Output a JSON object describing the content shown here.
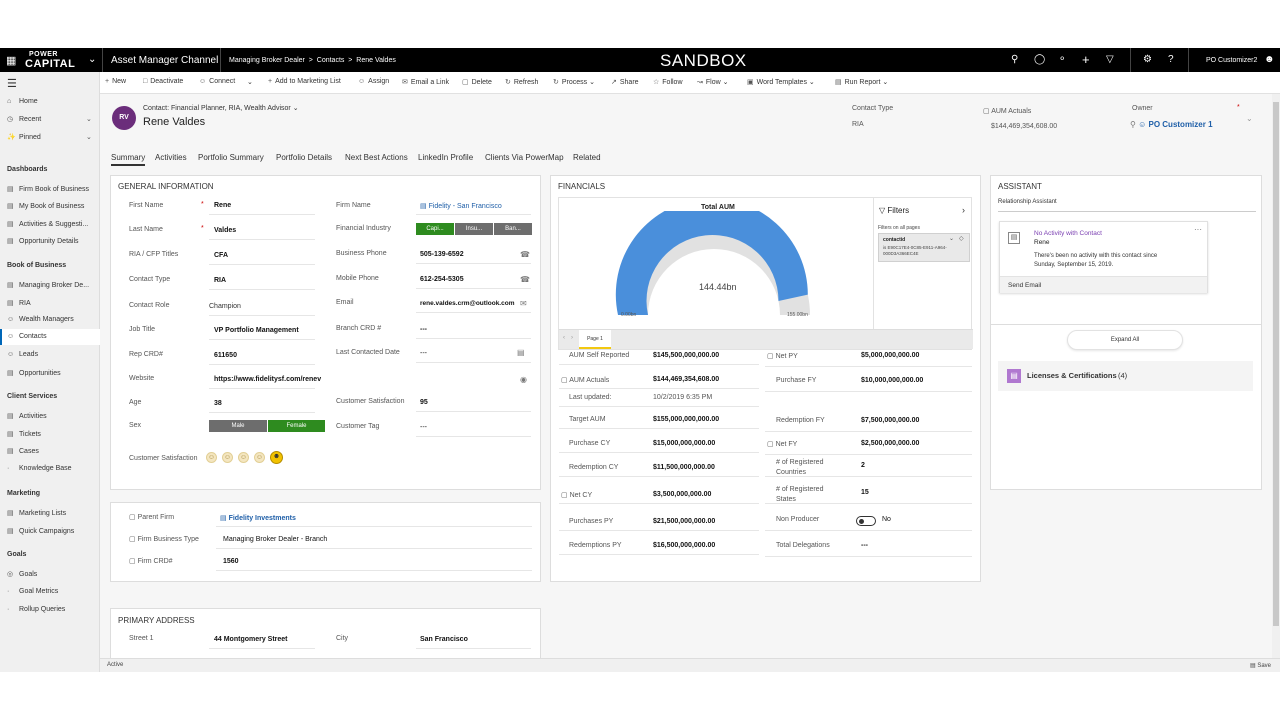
{
  "topbar": {
    "logo_line1": "POWER",
    "logo_line2": "CAPITAL",
    "app_name": "Asset Manager Channel",
    "breadcrumb": [
      "Managing Broker Dealer",
      "Contacts",
      "Rene Valdes"
    ],
    "environment": "SANDBOX",
    "user": "PO Customizer2"
  },
  "commands": [
    "New",
    "Deactivate",
    "Connect",
    "Add to Marketing List",
    "Assign",
    "Email a Link",
    "Delete",
    "Refresh",
    "Process",
    "Share",
    "Follow",
    "Flow",
    "Word Templates",
    "Run Report"
  ],
  "nav": {
    "top_items": [
      "Home",
      "Recent",
      "Pinned"
    ],
    "dashboards_title": "Dashboards",
    "dashboards": [
      "Firm Book of Business",
      "My Book of Business",
      "Activities & Suggesti...",
      "Opportunity Details"
    ],
    "book_title": "Book of Business",
    "book": [
      "Managing Broker De...",
      "RIA",
      "Wealth Managers",
      "Contacts",
      "Leads",
      "Opportunities"
    ],
    "client_title": "Client Services",
    "client": [
      "Activities",
      "Tickets",
      "Cases",
      "Knowledge Base"
    ],
    "marketing_title": "Marketing",
    "marketing": [
      "Marketing Lists",
      "Quick Campaigns"
    ],
    "goals_title": "Goals",
    "goals": [
      "Goals",
      "Goal Metrics",
      "Rollup Queries"
    ]
  },
  "header": {
    "initials": "RV",
    "form_name": "Contact: Financial Planner, RIA, Wealth Advisor",
    "name": "Rene Valdes",
    "contact_type_label": "Contact Type",
    "contact_type_value": "RIA",
    "aum_label": "AUM Actuals",
    "aum_value": "$144,469,354,608.00",
    "owner_label": "Owner",
    "owner_value": "PO Customizer 1"
  },
  "tabs": [
    "Summary",
    "Activities",
    "Portfolio Summary",
    "Portfolio Details",
    "Next Best Actions",
    "LinkedIn Profile",
    "Clients Via PowerMap",
    "Related"
  ],
  "general": {
    "title": "GENERAL INFORMATION",
    "first_name_label": "First Name",
    "first_name": "Rene",
    "last_name_label": "Last Name",
    "last_name": "Valdes",
    "titles_label": "RIA / CFP Titles",
    "titles": "CFA",
    "contact_type_label": "Contact Type",
    "contact_type": "RIA",
    "contact_role_label": "Contact Role",
    "contact_role": "Champion",
    "job_title_label": "Job Title",
    "job_title": "VP Portfolio Management",
    "rep_crd_label": "Rep CRD#",
    "rep_crd": "611650",
    "website_label": "Website",
    "website": "https://www.fidelitysf.com/renev",
    "age_label": "Age",
    "age": "38",
    "sex_label": "Sex",
    "sex_options": [
      "Male",
      "Female"
    ],
    "cust_sat_label": "Customer Satisfaction",
    "firm_name_label": "Firm Name",
    "firm_name": "Fidelity - San Francisco",
    "fin_industry_label": "Financial Industry",
    "fin_industry_options": [
      "Capi...",
      "Insu...",
      "Ban..."
    ],
    "business_phone_label": "Business Phone",
    "business_phone": "505-139-6592",
    "mobile_phone_label": "Mobile Phone",
    "mobile_phone": "612-254-5305",
    "email_label": "Email",
    "email": "rene.valdes.crm@outlook.com",
    "branch_crd_label": "Branch CRD #",
    "branch_crd": "---",
    "last_contacted_label": "Last Contacted Date",
    "last_contacted": "---",
    "cust_sat2_label": "Customer Satisfaction",
    "cust_sat2": "95",
    "cust_tag_label": "Customer Tag",
    "cust_tag": "---"
  },
  "firm": {
    "parent_label": "Parent Firm",
    "parent": "Fidelity Investments",
    "business_type_label": "Firm Business Type",
    "business_type": "Managing Broker Dealer - Branch",
    "crd_label": "Firm CRD#",
    "crd": "1560"
  },
  "address": {
    "title": "PRIMARY ADDRESS",
    "street_label": "Street 1",
    "street": "44 Montgomery Street",
    "city_label": "City",
    "city": "San Francisco"
  },
  "financials": {
    "title": "FINANCIALS",
    "gauge_title": "Total AUM",
    "gauge_center": "144.44bn",
    "gauge_min": "0.00bn",
    "gauge_max": "155.00bn",
    "filters_label": "Filters",
    "filters_on_pages": "Filters on all pages",
    "filter_field": "contactid",
    "filter_value": "is E90C17E4-0C85-E911-A964-000D3A366EC4E",
    "page_tab": "Page 1",
    "left": [
      {
        "label": "AUM Self Reported",
        "value": "$145,500,000,000.00"
      },
      {
        "label": "AUM Actuals",
        "value": "$144,469,354,608.00"
      },
      {
        "label": "Last updated:",
        "value": "10/2/2019 6:35 PM"
      },
      {
        "label": "Target AUM",
        "value": "$155,000,000,000.00"
      },
      {
        "label": "Purchase CY",
        "value": "$15,000,000,000.00"
      },
      {
        "label": "Redemption CY",
        "value": "$11,500,000,000.00"
      },
      {
        "label": "Net CY",
        "value": "$3,500,000,000.00"
      },
      {
        "label": "Purchases PY",
        "value": "$21,500,000,000.00"
      },
      {
        "label": "Redemptions PY",
        "value": "$16,500,000,000.00"
      }
    ],
    "right": [
      {
        "label": "Net PY",
        "value": "$5,000,000,000.00"
      },
      {
        "label": "Purchase FY",
        "value": "$10,000,000,000.00"
      },
      {
        "label": "Redemption FY",
        "value": "$7,500,000,000.00"
      },
      {
        "label": "Net FY",
        "value": "$2,500,000,000.00"
      },
      {
        "label": "# of Registered Countries",
        "value": "2"
      },
      {
        "label": "# of Registered States",
        "value": "15"
      },
      {
        "label": "Non Producer",
        "value": "No"
      },
      {
        "label": "Total Delegations",
        "value": "---"
      }
    ]
  },
  "assistant": {
    "title": "ASSISTANT",
    "subtitle": "Relationship Assistant",
    "card_title": "No Activity with Contact",
    "card_name": "Rene",
    "card_body_1": "There's been no activity with this contact since",
    "card_body_2": "Sunday, September 15, 2019.",
    "card_action": "Send Email",
    "expand_all": "Expand All",
    "licenses": "Licenses & Certifications",
    "licenses_count": "(4)"
  },
  "status": {
    "left": "Active",
    "right": "Save"
  },
  "colors": {
    "accent": "#0067b8",
    "gauge": "#4a8fdb",
    "avatar": "#6b2d7b",
    "green": "#2e8b1f",
    "gray": "#6d6d6d"
  }
}
